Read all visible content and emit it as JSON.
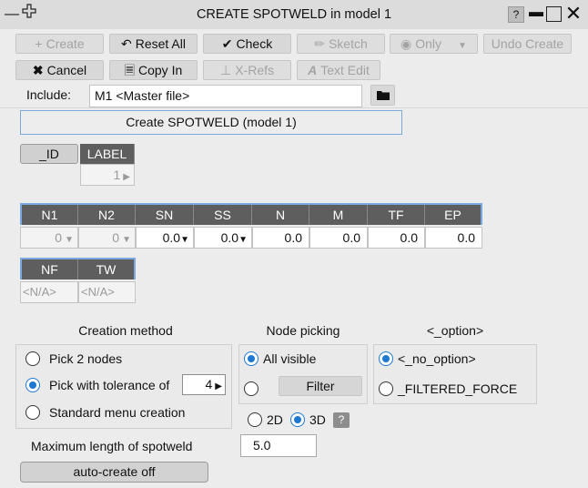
{
  "window": {
    "title": "CREATE SPOTWELD in model 1",
    "help": "?"
  },
  "toolbar_row1": {
    "create": "Create",
    "reset_all": "Reset All",
    "check": "Check",
    "sketch": "Sketch",
    "only": "Only",
    "undo_create": "Undo Create"
  },
  "toolbar_row2": {
    "cancel": "Cancel",
    "copy_in": "Copy In",
    "xrefs": "X-Refs",
    "text_edit": "Text Edit"
  },
  "include": {
    "label": "Include:",
    "value": "M1  <Master file>"
  },
  "header": "Create SPOTWELD (model 1)",
  "id_button": "_ID",
  "label_field": {
    "header": "LABEL",
    "value": "1"
  },
  "table1": {
    "headers": [
      "N1",
      "N2",
      "SN",
      "SS",
      "N",
      "M",
      "TF",
      "EP"
    ],
    "values": [
      "0",
      "0",
      "0.0",
      "0.0",
      "0.0",
      "0.0",
      "0.0",
      "0.0"
    ]
  },
  "table2": {
    "headers": [
      "NF",
      "TW"
    ],
    "values": [
      "<N/A>",
      "<N/A>"
    ]
  },
  "creation_method": {
    "title": "Creation method",
    "options": [
      "Pick 2 nodes",
      "Pick with tolerance of",
      "Standard menu creation"
    ],
    "selected_index": 1,
    "tolerance": "4"
  },
  "node_picking": {
    "title": "Node picking",
    "all_visible": "All visible",
    "filter": "Filter",
    "mode_2d": "2D",
    "mode_3d": "3D",
    "selected_mode": "3D",
    "help": "?"
  },
  "option": {
    "title": "<_option>",
    "options": [
      "<_no_option>",
      "_FILTERED_FORCE"
    ],
    "selected_index": 0
  },
  "max_length": {
    "label": "Maximum length of spotweld",
    "value": "5.0"
  },
  "auto_create": "auto-create off"
}
